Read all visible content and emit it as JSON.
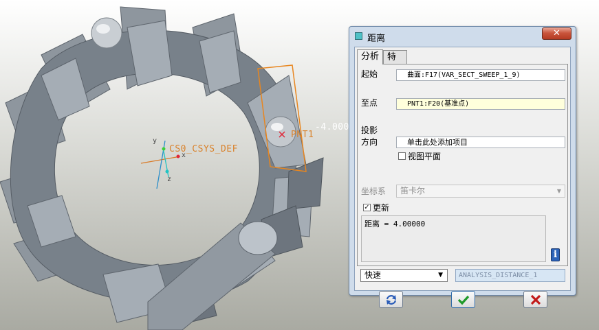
{
  "viewport": {
    "csys_label": "CS0_CSYS_DEF",
    "point_label": "PNT1",
    "distance_label": "-4.000",
    "axis_x": "x",
    "axis_y": "y",
    "axis_z": "z"
  },
  "dialog": {
    "title": "距离",
    "close_label": "✕",
    "tabs": [
      "分析",
      "特征"
    ],
    "from_label": "起始",
    "from_value": "曲面:F17(VAR_SECT_SWEEP_1_9)",
    "to_label": "至点",
    "to_value": "PNT1:F20(基准点)",
    "projection_label_1": "投影",
    "projection_label_2": "方向",
    "projection_value": "单击此处添加项目",
    "view_plane_label": "视图平面",
    "view_plane_checked": false,
    "csys_label": "坐标系",
    "csys_value": "笛卡尔",
    "update_label": "更新",
    "update_checked": true,
    "result_text": "距离  = 4.00000",
    "mode_value": "快速",
    "analysis_name": "ANALYSIS_DISTANCE_1",
    "buttons": {
      "repeat": "repeat-icon",
      "ok": "check-icon",
      "cancel": "cross-icon"
    },
    "colors": {
      "ok_green": "#1f9a2a",
      "cancel_red": "#c21a1a",
      "highlight_orange": "#e8861f"
    }
  }
}
